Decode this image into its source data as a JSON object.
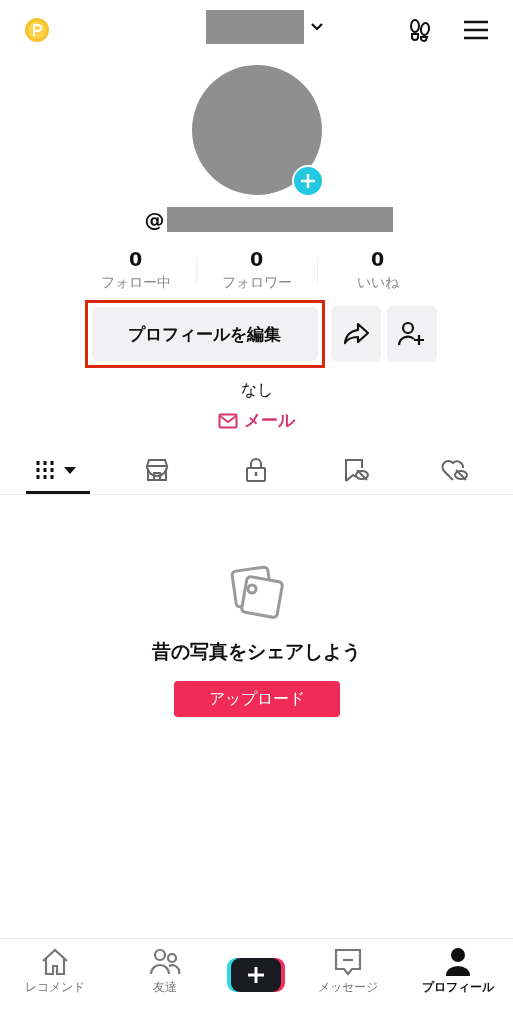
{
  "header": {
    "username_redacted": true
  },
  "profile": {
    "handle_prefix": "@",
    "stats": [
      {
        "value": "0",
        "label": "フォロー中"
      },
      {
        "value": "0",
        "label": "フォロワー"
      },
      {
        "value": "0",
        "label": "いいね"
      }
    ],
    "edit_button": {
      "label": "プロフィールを編集",
      "highlighted": true
    },
    "bio": "なし",
    "email_link": "メール"
  },
  "tabs": [
    {
      "kind": "grid",
      "selected": true
    },
    {
      "kind": "shop",
      "selected": false
    },
    {
      "kind": "lock",
      "selected": false
    },
    {
      "kind": "bookmark-hidden",
      "selected": false
    },
    {
      "kind": "heart-hidden",
      "selected": false
    }
  ],
  "empty_state": {
    "message": "昔の写真をシェアしよう",
    "button": "アップロード"
  },
  "bottom_nav": [
    {
      "kind": "home",
      "label": "レコメンド",
      "selected": false
    },
    {
      "kind": "friends",
      "label": "友達",
      "selected": false
    },
    {
      "kind": "create",
      "selected": false
    },
    {
      "kind": "inbox",
      "label": "メッセージ",
      "selected": false
    },
    {
      "kind": "profile",
      "label": "プロフィール",
      "selected": true
    }
  ]
}
